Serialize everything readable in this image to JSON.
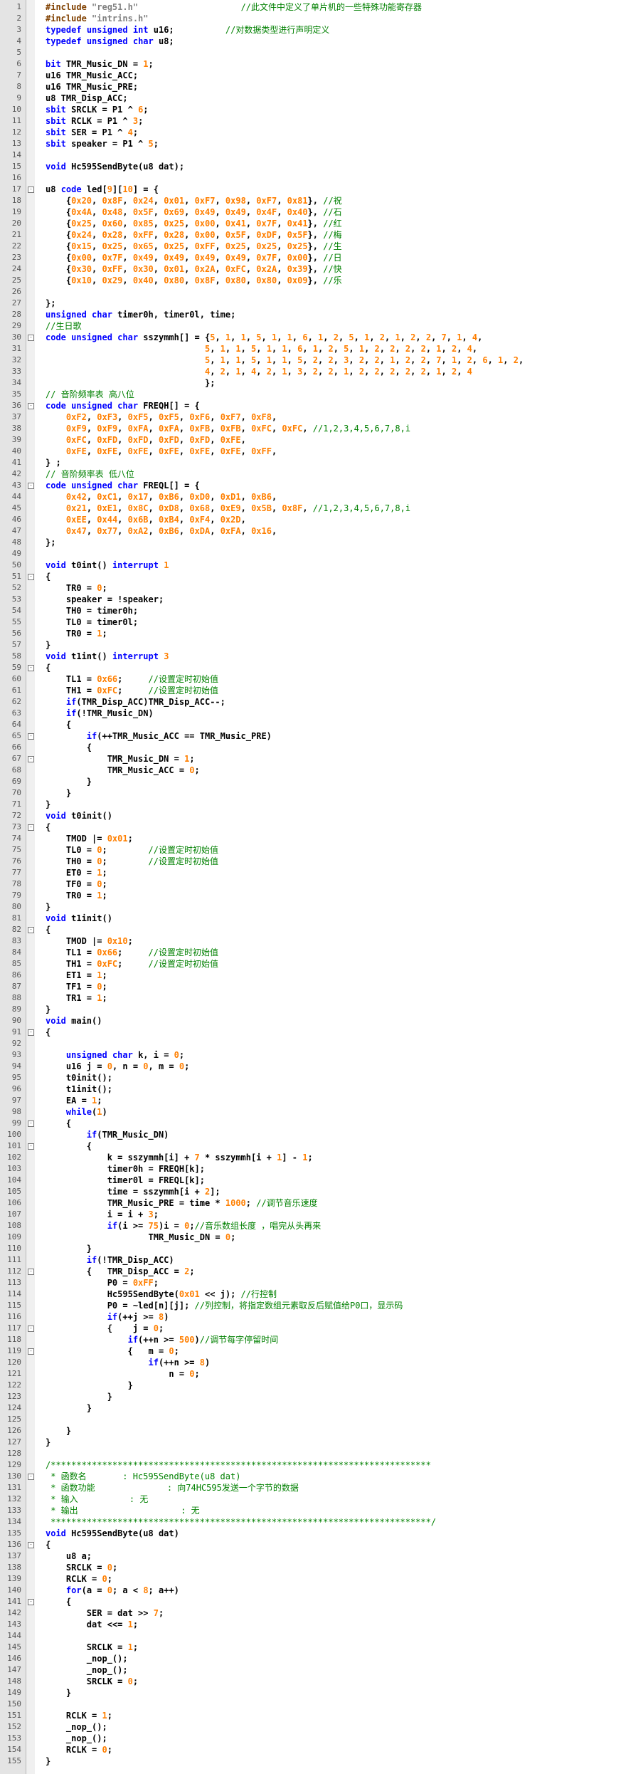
{
  "editor": {
    "language": "C",
    "colors": {
      "background": "#ffffff",
      "gutter": "#e4e4e4",
      "keyword": "#0000ff",
      "number": "#ff7f00",
      "string": "#808080",
      "comment": "#008000",
      "preprocessor": "#804000",
      "text": "#000000"
    },
    "lines": [
      "#include \"reg51.h\"                    //此文件中定义了单片机的一些特殊功能寄存器",
      "#include \"intrins.h\"",
      "typedef unsigned int u16;          //对数据类型进行声明定义",
      "typedef unsigned char u8;",
      "",
      "bit TMR_Music_DN = 1;",
      "u16 TMR_Music_ACC;",
      "u16 TMR_Music_PRE;",
      "u8 TMR_Disp_ACC;",
      "sbit SRCLK = P1 ^ 6;",
      "sbit RCLK = P1 ^ 3;",
      "sbit SER = P1 ^ 4;",
      "sbit speaker = P1 ^ 5;",
      "",
      "void Hc595SendByte(u8 dat);",
      "",
      "u8 code led[9][10] = {",
      "    {0x20, 0x8F, 0x24, 0x01, 0xF7, 0x98, 0xF7, 0x81}, //祝",
      "    {0x4A, 0x48, 0x5F, 0x69, 0x49, 0x49, 0x4F, 0x40}, //石",
      "    {0x25, 0x60, 0x85, 0x25, 0x00, 0x41, 0x7F, 0x41}, //红",
      "    {0x24, 0x28, 0xFF, 0x28, 0x00, 0x5F, 0xDF, 0x5F}, //梅",
      "    {0x15, 0x25, 0x65, 0x25, 0xFF, 0x25, 0x25, 0x25}, //生",
      "    {0x00, 0x7F, 0x49, 0x49, 0x49, 0x49, 0x7F, 0x00}, //日",
      "    {0x30, 0xFF, 0x30, 0x01, 0x2A, 0xFC, 0x2A, 0x39}, //快",
      "    {0x10, 0x29, 0x40, 0x80, 0x8F, 0x80, 0x80, 0x09}, //乐",
      "",
      "};",
      "unsigned char timer0h, timer0l, time;",
      "//生日歌",
      "code unsigned char sszymmh[] = {5, 1, 1, 5, 1, 1, 6, 1, 2, 5, 1, 2, 1, 2, 2, 7, 1, 4,",
      "                               5, 1, 1, 5, 1, 1, 6, 1, 2, 5, 1, 2, 2, 2, 2, 1, 2, 4,",
      "                               5, 1, 1, 5, 1, 1, 5, 2, 2, 3, 2, 2, 1, 2, 2, 7, 1, 2, 6, 1, 2,",
      "                               4, 2, 1, 4, 2, 1, 3, 2, 2, 1, 2, 2, 2, 2, 2, 1, 2, 4",
      "                               };",
      "// 音阶频率表 高八位",
      "code unsigned char FREQH[] = {",
      "    0xF2, 0xF3, 0xF5, 0xF5, 0xF6, 0xF7, 0xF8,",
      "    0xF9, 0xF9, 0xFA, 0xFA, 0xFB, 0xFB, 0xFC, 0xFC, //1,2,3,4,5,6,7,8,i",
      "    0xFC, 0xFD, 0xFD, 0xFD, 0xFD, 0xFE,",
      "    0xFE, 0xFE, 0xFE, 0xFE, 0xFE, 0xFE, 0xFF,",
      "} ;",
      "// 音阶频率表 低八位",
      "code unsigned char FREQL[] = {",
      "    0x42, 0xC1, 0x17, 0xB6, 0xD0, 0xD1, 0xB6,",
      "    0x21, 0xE1, 0x8C, 0xD8, 0x68, 0xE9, 0x5B, 0x8F, //1,2,3,4,5,6,7,8,i",
      "    0xEE, 0x44, 0x6B, 0xB4, 0xF4, 0x2D,",
      "    0x47, 0x77, 0xA2, 0xB6, 0xDA, 0xFA, 0x16,",
      "};",
      "",
      "void t0int() interrupt 1",
      "{",
      "    TR0 = 0;",
      "    speaker = !speaker;",
      "    TH0 = timer0h;",
      "    TL0 = timer0l;",
      "    TR0 = 1;",
      "}",
      "void t1int() interrupt 3",
      "{",
      "    TL1 = 0x66;     //设置定时初始值",
      "    TH1 = 0xFC;     //设置定时初始值",
      "    if(TMR_Disp_ACC)TMR_Disp_ACC--;",
      "    if(!TMR_Music_DN)",
      "    {",
      "        if(++TMR_Music_ACC == TMR_Music_PRE)",
      "        {",
      "            TMR_Music_DN = 1;",
      "            TMR_Music_ACC = 0;",
      "        }",
      "    }",
      "}",
      "void t0init()",
      "{",
      "    TMOD |= 0x01;",
      "    TL0 = 0;        //设置定时初始值",
      "    TH0 = 0;        //设置定时初始值",
      "    ET0 = 1;",
      "    TF0 = 0;",
      "    TR0 = 1;",
      "}",
      "void t1init()",
      "{",
      "    TMOD |= 0x10;",
      "    TL1 = 0x66;     //设置定时初始值",
      "    TH1 = 0xFC;     //设置定时初始值",
      "    ET1 = 1;",
      "    TF1 = 0;",
      "    TR1 = 1;",
      "}",
      "void main()",
      "{",
      "",
      "    unsigned char k, i = 0;",
      "    u16 j = 0, n = 0, m = 0;",
      "    t0init();",
      "    t1init();",
      "    EA = 1;",
      "    while(1)",
      "    {",
      "        if(TMR_Music_DN)",
      "        {",
      "            k = sszymmh[i] + 7 * sszymmh[i + 1] - 1;",
      "            timer0h = FREQH[k];",
      "            timer0l = FREQL[k];",
      "            time = sszymmh[i + 2];",
      "            TMR_Music_PRE = time * 1000; //调节音乐速度",
      "            i = i + 3;",
      "            if(i >= 75)i = 0;//音乐数组长度 ，唱完从头再来",
      "                    TMR_Music_DN = 0;",
      "        }",
      "        if(!TMR_Disp_ACC)",
      "        {   TMR_Disp_ACC = 2;",
      "            P0 = 0xFF;",
      "            Hc595SendByte(0x01 << j); //行控制",
      "            P0 = ~led[n][j]; //列控制，将指定数组元素取反后赋值给P0口，显示码",
      "            if(++j >= 8)",
      "            {    j = 0;",
      "                if(++n >= 500)//调节每字停留时间",
      "                {   m = 0;",
      "                    if(++n >= 8)",
      "                        n = 0;",
      "                }",
      "            }",
      "        }",
      "",
      "    }",
      "}",
      "",
      "/**************************************************************************",
      " * 函数名       : Hc595SendByte(u8 dat)",
      " * 函数功能              : 向74HC595发送一个字节的数据",
      " * 输入          : 无",
      " * 输出                    : 无",
      " **************************************************************************/",
      "void Hc595SendByte(u8 dat)",
      "{",
      "    u8 a;",
      "    SRCLK = 0;",
      "    RCLK = 0;",
      "    for(a = 0; a < 8; a++)",
      "    {",
      "        SER = dat >> 7;",
      "        dat <<= 1;",
      "",
      "        SRCLK = 1;",
      "        _nop_();",
      "        _nop_();",
      "        SRCLK = 0;",
      "    }",
      "",
      "    RCLK = 1;",
      "    _nop_();",
      "    _nop_();",
      "    RCLK = 0;",
      "}"
    ],
    "fold_markers": {
      "17": "-",
      "30": "-",
      "36": "-",
      "43": "-",
      "51": "-",
      "59": "-",
      "65": "-",
      "67": "-",
      "73": "-",
      "82": "-",
      "91": "-",
      "99": "-",
      "101": "-",
      "112": "-",
      "117": "-",
      "119": "-",
      "130": "-",
      "136": "-",
      "141": "-"
    }
  }
}
